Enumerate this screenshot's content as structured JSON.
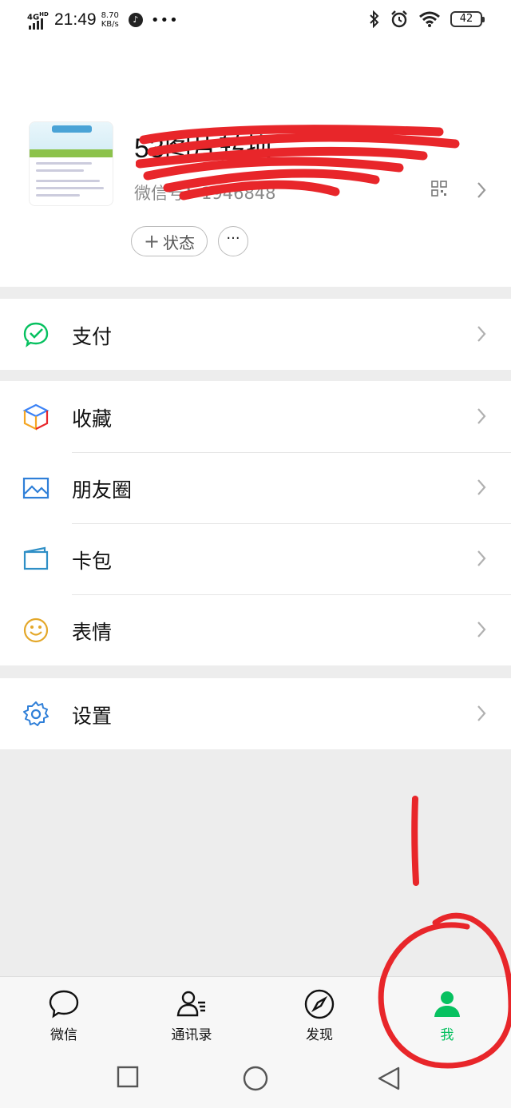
{
  "status_bar": {
    "network": "4G",
    "network_suffix": "HD",
    "time": "21:49",
    "speed_value": "8.70",
    "speed_unit": "KB/s",
    "battery": "42",
    "icons": [
      "signal-icon",
      "music-icon",
      "more-dots-icon",
      "bluetooth-icon",
      "alarm-icon",
      "wifi-icon",
      "battery-icon"
    ]
  },
  "profile": {
    "nickname": "53图片转换 ···",
    "wxid": "微信号：1946848",
    "status_button": "状态",
    "more_button": "···"
  },
  "menu": {
    "pay": "支付",
    "favorites": "收藏",
    "moments": "朋友圈",
    "cards": "卡包",
    "stickers": "表情",
    "settings": "设置"
  },
  "tabs": [
    {
      "label": "微信",
      "icon": "chat-bubble-icon",
      "active": false
    },
    {
      "label": "通讯录",
      "icon": "contacts-icon",
      "active": false
    },
    {
      "label": "发现",
      "icon": "compass-icon",
      "active": false
    },
    {
      "label": "我",
      "icon": "person-icon",
      "active": true
    }
  ],
  "colors": {
    "accent": "#07c160",
    "annotation": "#e8262a",
    "background": "#ededed"
  }
}
